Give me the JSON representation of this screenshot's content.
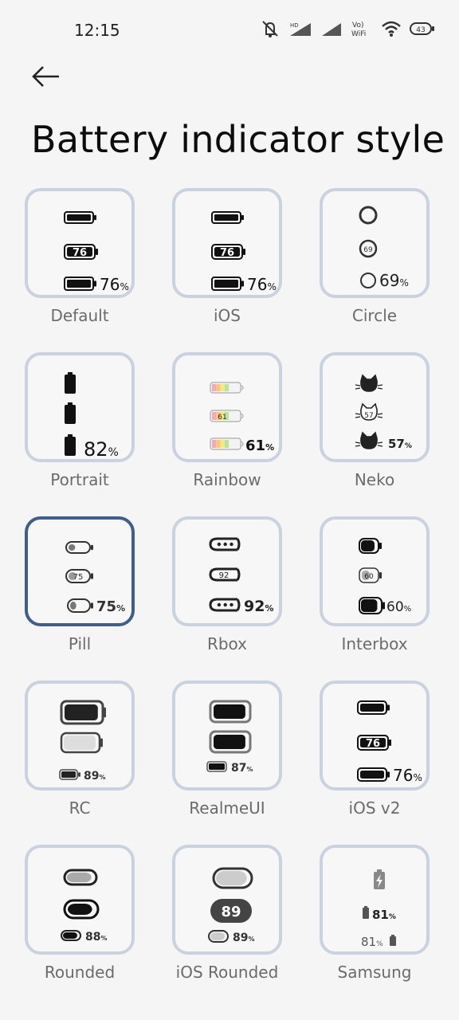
{
  "status_bar": {
    "time": "12:15",
    "icons": [
      "mute-icon",
      "hd-signal-icon",
      "signal-icon",
      "vowifi-icon",
      "wifi-icon",
      "battery-icon"
    ],
    "vowifi_text": "Vo) WiFi",
    "hd_text": "HD",
    "battery_level": "43"
  },
  "header": {
    "back_icon": "arrow-left-icon",
    "title": "Battery indicator style"
  },
  "styles": [
    {
      "label": "Default",
      "values": [
        "76",
        "76%"
      ]
    },
    {
      "label": "iOS",
      "values": [
        "76",
        "76%"
      ]
    },
    {
      "label": "Circle",
      "values": [
        "69",
        "69%"
      ]
    },
    {
      "label": "Portrait",
      "values": [
        "82%"
      ]
    },
    {
      "label": "Rainbow",
      "values": [
        "61",
        "61%"
      ]
    },
    {
      "label": "Neko",
      "values": [
        "57",
        "57%"
      ]
    },
    {
      "label": "Pill",
      "values": [
        "75",
        "75%"
      ],
      "selected": true
    },
    {
      "label": "Rbox",
      "values": [
        "92",
        "92%"
      ]
    },
    {
      "label": "Interbox",
      "values": [
        "60",
        "60%"
      ]
    },
    {
      "label": "RC",
      "values": [
        "89%"
      ]
    },
    {
      "label": "RealmeUI",
      "values": [
        "87%"
      ]
    },
    {
      "label": "iOS v2",
      "values": [
        "76",
        "76%"
      ]
    },
    {
      "label": "Rounded",
      "values": [
        "88%"
      ]
    },
    {
      "label": "iOS Rounded",
      "values": [
        "89",
        "89%"
      ]
    },
    {
      "label": "Samsung",
      "values": [
        "81%",
        "81%"
      ]
    }
  ],
  "colors": {
    "card_border": "#c9d2de",
    "selected_border": "#3f5e8c",
    "label": "#6b6b6b"
  }
}
